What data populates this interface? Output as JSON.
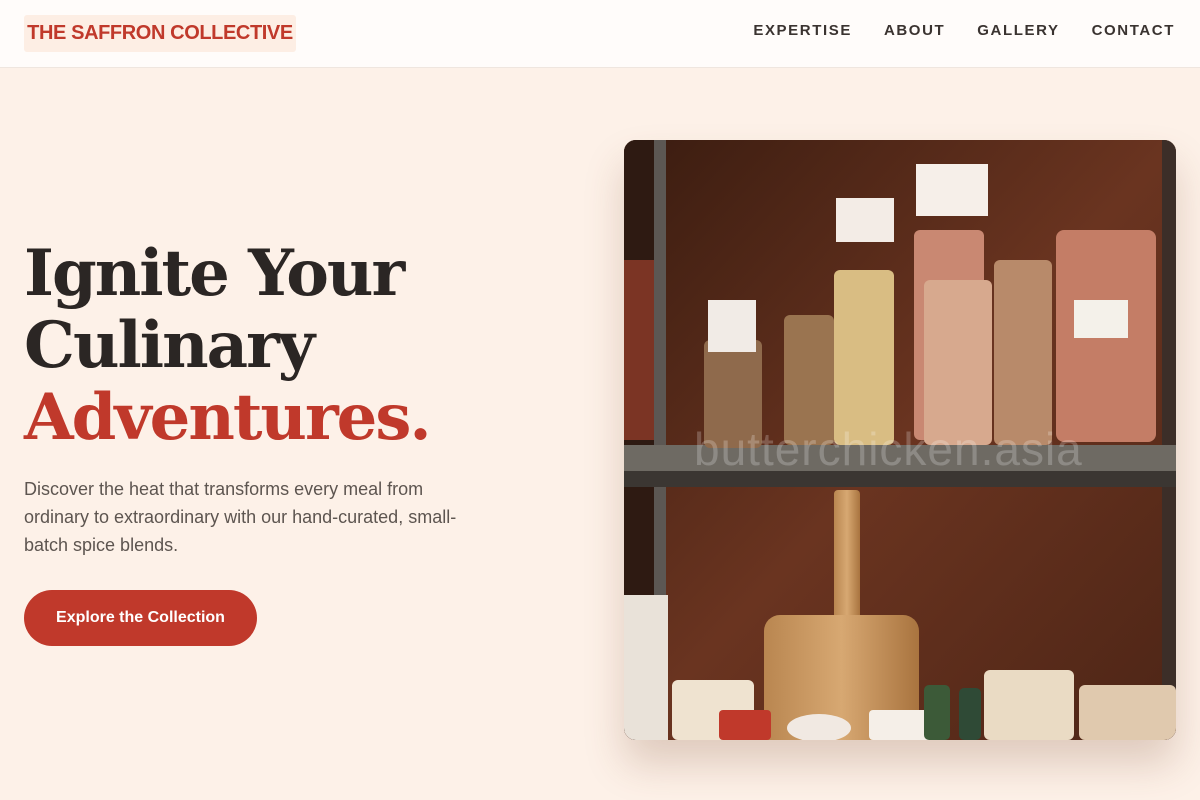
{
  "brand": {
    "name": "THE SAFFRON COLLECTIVE"
  },
  "nav": {
    "items": [
      "EXPERTISE",
      "ABOUT",
      "GALLERY",
      "CONTACT"
    ]
  },
  "hero": {
    "title_line1": "Ignite Your",
    "title_line2": "Culinary",
    "title_accent": "Adventures.",
    "subtitle": "Discover the heat that transforms every meal from ordinary to extraordinary with our hand-curated, small-batch spice blends.",
    "cta_label": "Explore the Collection"
  },
  "image": {
    "watermark": "butterchicken.asia"
  },
  "colors": {
    "accent": "#c0392b",
    "background": "#fdf1e8"
  }
}
